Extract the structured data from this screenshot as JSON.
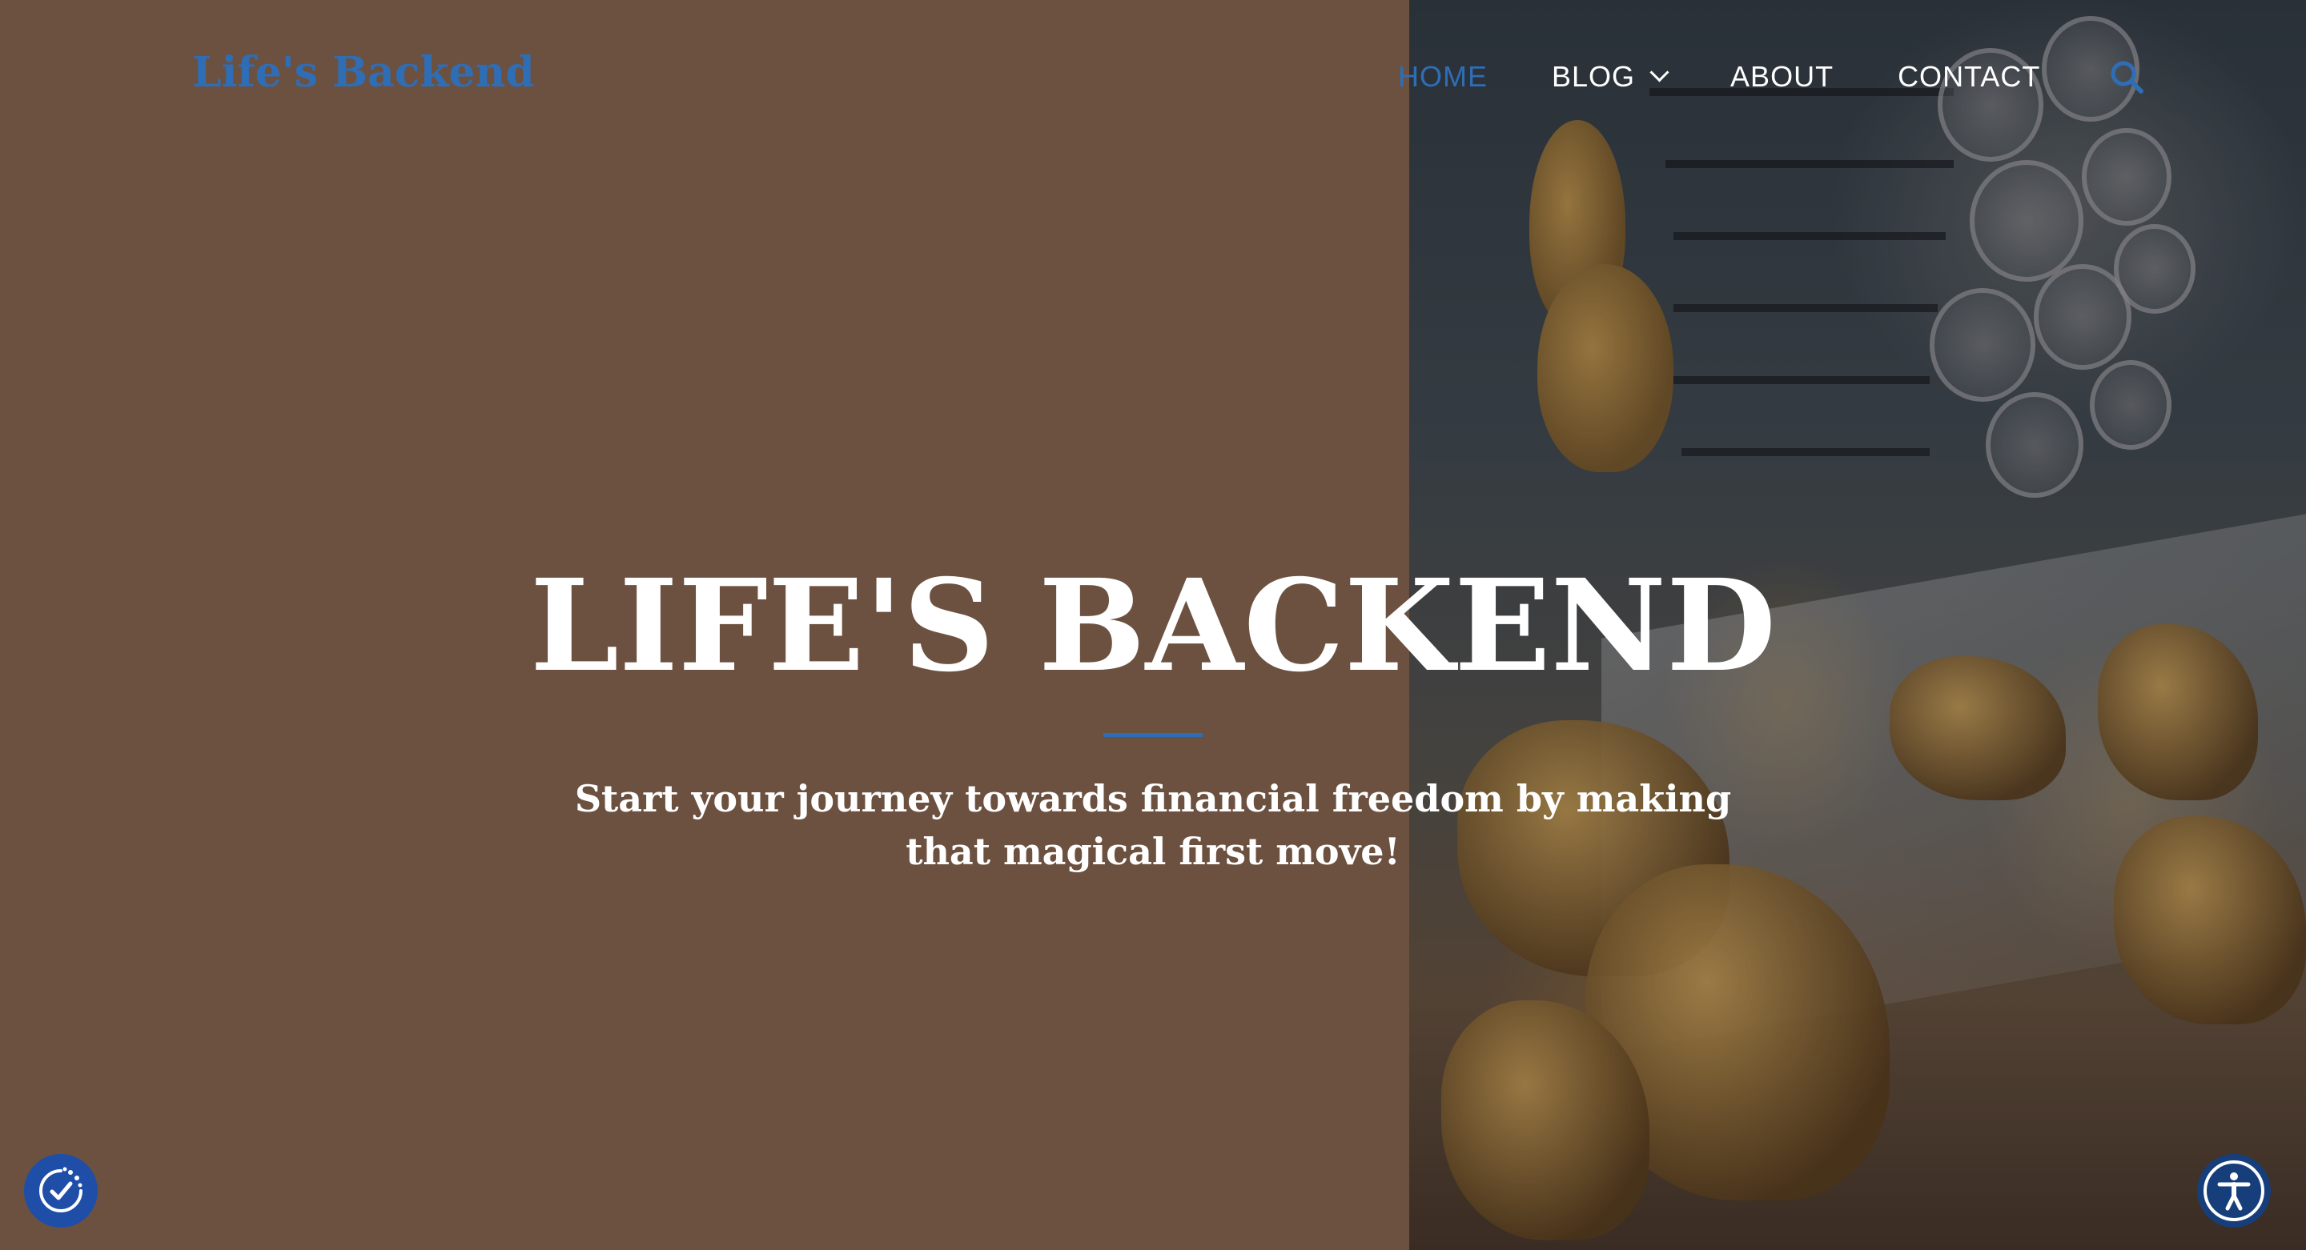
{
  "header": {
    "logo_text": "Life's Backend",
    "nav": {
      "home": "HOME",
      "blog": "BLOG",
      "about": "ABOUT",
      "contact": "CONTACT"
    },
    "icons": {
      "search": "search-icon",
      "blog_dropdown": "chevron-down-icon"
    }
  },
  "hero": {
    "title": "LIFE'S BACKEND",
    "subtitle": "Start your journey towards financial freedom by making that magical first move!"
  },
  "floating": {
    "consent_icon": "cookie-consent-icon",
    "accessibility_icon": "accessibility-icon"
  },
  "colors": {
    "background": "#6c5140",
    "accent": "#2f6db5",
    "text": "#ffffff"
  }
}
